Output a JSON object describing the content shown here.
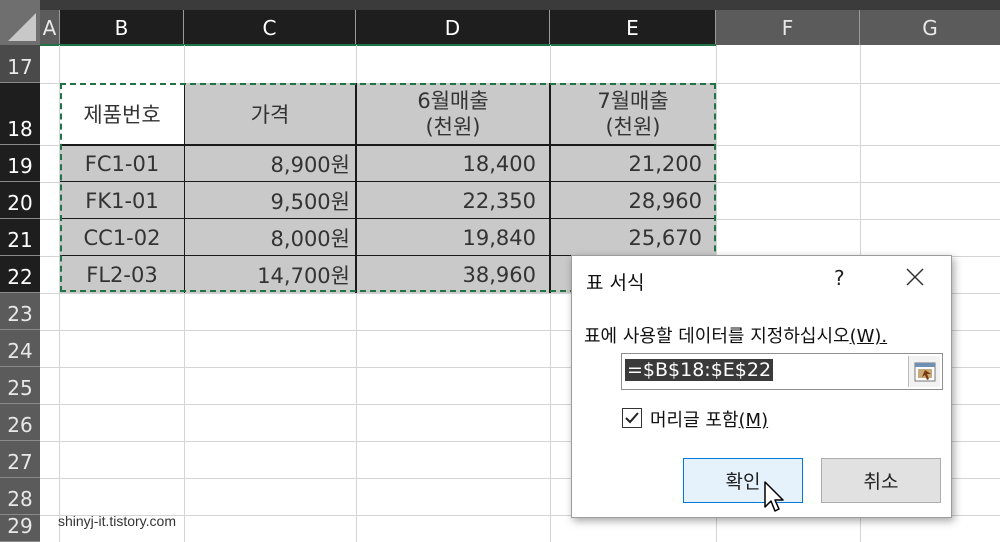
{
  "columns": [
    {
      "id": "A",
      "label": "A",
      "selected": false
    },
    {
      "id": "B",
      "label": "B",
      "selected": true
    },
    {
      "id": "C",
      "label": "C",
      "selected": true
    },
    {
      "id": "D",
      "label": "D",
      "selected": true
    },
    {
      "id": "E",
      "label": "E",
      "selected": true
    },
    {
      "id": "F",
      "label": "F",
      "selected": false
    },
    {
      "id": "G",
      "label": "G",
      "selected": false
    }
  ],
  "rows": [
    "17",
    "18",
    "19",
    "20",
    "21",
    "22",
    "23",
    "24",
    "25",
    "26",
    "27",
    "28",
    "29"
  ],
  "table": {
    "headers": [
      "제품번호",
      "가격",
      "6월매출\n(천원)",
      "7월매출\n(천원)"
    ],
    "data": [
      [
        "FC1-01",
        "8,900원",
        "18,400",
        "21,200"
      ],
      [
        "FK1-01",
        "9,500원",
        "22,350",
        "28,960"
      ],
      [
        "CC1-02",
        "8,000원",
        "19,840",
        "25,670"
      ],
      [
        "FL2-03",
        "14,700원",
        "38,960",
        ""
      ]
    ]
  },
  "dialog": {
    "title": "표 서식",
    "help": "?",
    "prompt": "표에 사용할 데이터를 지정하십시오",
    "prompt_key": "(W).",
    "range": "=$B$18:$E$22",
    "checkbox_label": "머리글 포함",
    "checkbox_key": "(M)",
    "checked": true,
    "ok_label": "확인",
    "cancel_label": "취소"
  },
  "watermark": "shinyj-it.tistory.com",
  "colors": {
    "selection_gray": "#c9c9c9",
    "marquee_green": "#217346",
    "ok_border": "#0078d7"
  }
}
